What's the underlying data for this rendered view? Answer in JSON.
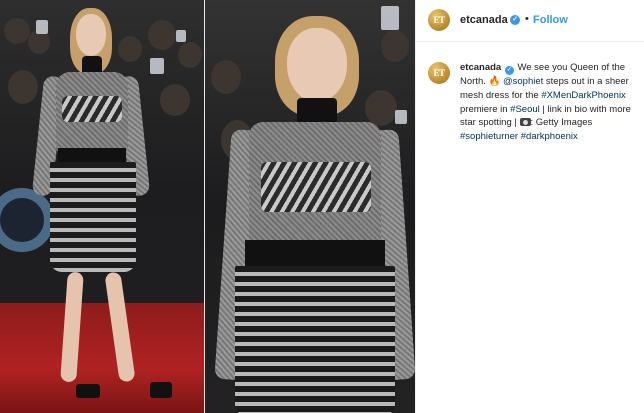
{
  "post": {
    "image": {
      "description_icon": "photo-collage"
    },
    "header": {
      "avatar_text": "ET",
      "username": "etcanada",
      "verified_glyph": "✓",
      "separator": "•",
      "follow_label": "Follow"
    },
    "caption": {
      "avatar_text": "ET",
      "username": "etcanada",
      "verified_glyph": "✓",
      "text_1": " We see you Queen of the North. ",
      "fire_emoji": "🔥",
      "mention": "@sophiet",
      "text_2": " steps out in a sheer mesh dress for the ",
      "hashtag_1": "#XMenDarkPhoenix",
      "text_3": " premiere in ",
      "hashtag_2": "#Seoul",
      "text_4": " | link in bio with more star spotting | ",
      "text_5": ": Getty Images ",
      "hashtag_3": "#sophieturner",
      "space": " ",
      "hashtag_4": "#darkphoenix"
    },
    "colors": {
      "link": "#003569",
      "follow": "#3897f0",
      "verified": "#3897f0",
      "text": "#262626"
    }
  }
}
